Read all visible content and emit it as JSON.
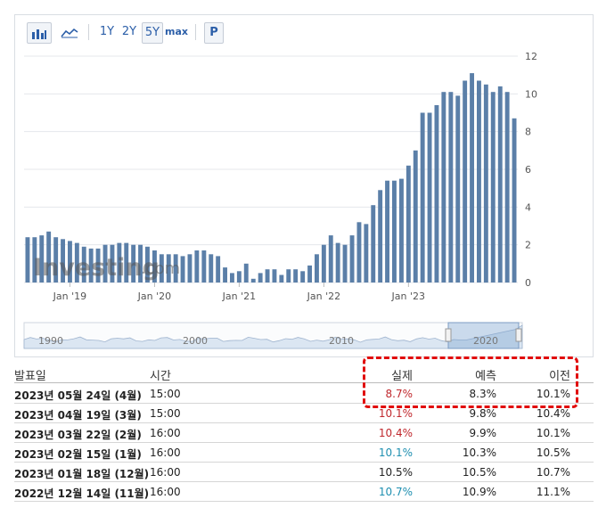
{
  "toolbar": {
    "bar_icon": "bar-chart-icon",
    "line_icon": "line-chart-icon",
    "range_1y": "1Y",
    "range_2y": "2Y",
    "range_5y": "5Y",
    "range_max": "max",
    "print_label": "P",
    "selected_range": "5Y"
  },
  "watermark": {
    "brand": "Investing",
    "suffix": ".com"
  },
  "colors": {
    "bar": "#5b7fa8",
    "bar_light": "#a7bbd3",
    "grid": "#e4e7eb",
    "axis_text": "#555555",
    "actual_red": "#c0282d",
    "actual_blue": "#1e8fb0",
    "highlight": "#e10b0b",
    "navigator_fill": "#dbe6f2"
  },
  "chart_data": {
    "type": "bar",
    "x_tick_labels": [
      "Jan '19",
      "Jan '20",
      "Jan '21",
      "Jan '22",
      "Jan '23"
    ],
    "y_ticks": [
      0,
      2,
      4,
      6,
      8,
      10,
      12
    ],
    "ylim": [
      0,
      12
    ],
    "y_axis_position": "right",
    "grid": true,
    "start_month": "2018-07",
    "values": [
      2.4,
      2.4,
      2.5,
      2.7,
      2.4,
      2.3,
      2.2,
      2.1,
      1.9,
      1.8,
      1.8,
      2.0,
      2.0,
      2.1,
      2.1,
      2.0,
      2.0,
      1.9,
      1.7,
      1.5,
      1.5,
      1.5,
      1.4,
      1.5,
      1.7,
      1.7,
      1.5,
      1.4,
      0.8,
      0.5,
      0.6,
      1.0,
      0.2,
      0.5,
      0.7,
      0.7,
      0.4,
      0.7,
      0.7,
      0.6,
      0.9,
      1.5,
      2.0,
      2.5,
      2.1,
      2.0,
      2.5,
      3.2,
      3.1,
      4.1,
      4.9,
      5.4,
      5.4,
      5.5,
      6.2,
      7.0,
      9.0,
      9.0,
      9.4,
      10.1,
      10.1,
      9.9,
      10.7,
      11.1,
      10.7,
      10.5,
      10.1,
      10.4,
      10.1,
      8.7
    ],
    "navigator_labels": [
      "1990",
      "2000",
      "2010",
      "2020"
    ]
  },
  "table": {
    "headers": {
      "date": "발표일",
      "time": "시간",
      "actual": "실제",
      "forecast": "예측",
      "previous": "이전"
    },
    "rows": [
      {
        "date": "2023년 05월 24일 (4월)",
        "time": "15:00",
        "actual": "8.7%",
        "forecast": "8.3%",
        "previous": "10.1%",
        "actual_color": "red"
      },
      {
        "date": "2023년 04월 19일 (3월)",
        "time": "15:00",
        "actual": "10.1%",
        "forecast": "9.8%",
        "previous": "10.4%",
        "actual_color": "red"
      },
      {
        "date": "2023년 03월 22일 (2월)",
        "time": "16:00",
        "actual": "10.4%",
        "forecast": "9.9%",
        "previous": "10.1%",
        "actual_color": "red"
      },
      {
        "date": "2023년 02월 15일 (1월)",
        "time": "16:00",
        "actual": "10.1%",
        "forecast": "10.3%",
        "previous": "10.5%",
        "actual_color": "blue"
      },
      {
        "date": "2023년 01월 18일 (12월)",
        "time": "16:00",
        "actual": "10.5%",
        "forecast": "10.5%",
        "previous": "10.7%",
        "actual_color": "none"
      },
      {
        "date": "2022년 12월 14일 (11월)",
        "time": "16:00",
        "actual": "10.7%",
        "forecast": "10.9%",
        "previous": "11.1%",
        "actual_color": "blue"
      }
    ]
  }
}
